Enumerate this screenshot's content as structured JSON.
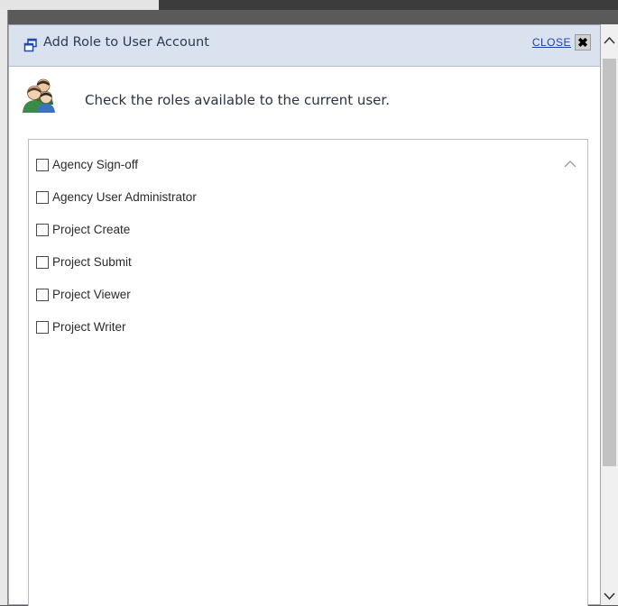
{
  "dialog": {
    "title": "Add Role to User Account",
    "close_label": "CLOSE",
    "close_glyph": "✖",
    "instructions": "Check the roles available to the current user.",
    "icons": {
      "title": "restore-window-icon",
      "header": "users-group-icon",
      "close": "close-x-icon"
    }
  },
  "roles": [
    {
      "label": "Agency Sign-off",
      "checked": false
    },
    {
      "label": "Agency User Administrator",
      "checked": false
    },
    {
      "label": "Project Create",
      "checked": false
    },
    {
      "label": "Project Submit",
      "checked": false
    },
    {
      "label": "Project Viewer",
      "checked": false
    },
    {
      "label": "Project Writer",
      "checked": false
    }
  ],
  "colors": {
    "titlebar_bg": "#d9e2ee",
    "title_text": "#2b3a55",
    "close_link": "#1f3fb0",
    "scroll_thumb": "#c2c2c2"
  }
}
